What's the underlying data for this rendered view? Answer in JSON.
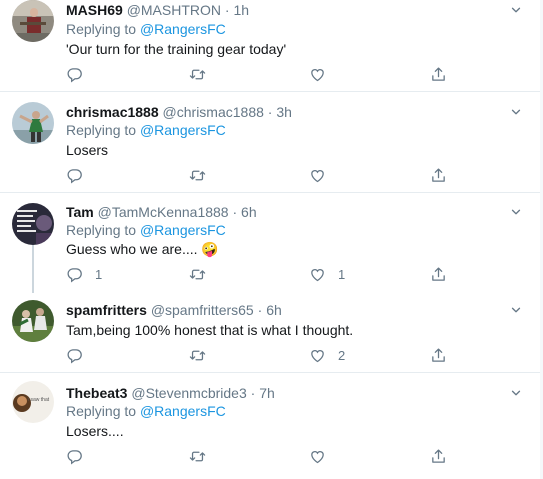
{
  "tweets": [
    {
      "name": "MASH69",
      "handle": "@MASHTRON",
      "dot": "·",
      "time": "1h",
      "replying_prefix": "Replying to",
      "replying_to": "@RangersFC",
      "text": "'Our turn for the training gear today'",
      "replies": "",
      "retweets": "",
      "likes": ""
    },
    {
      "name": "chrismac1888",
      "handle": "@chrismac1888",
      "dot": "·",
      "time": "3h",
      "replying_prefix": "Replying to",
      "replying_to": "@RangersFC",
      "text": "Losers",
      "replies": "",
      "retweets": "",
      "likes": ""
    },
    {
      "name": "Tam",
      "handle": "@TamMcKenna1888",
      "dot": "·",
      "time": "6h",
      "replying_prefix": "Replying to",
      "replying_to": "@RangersFC",
      "text": "Guess who we are....",
      "emoji": "🤪",
      "replies": "1",
      "retweets": "",
      "likes": "1"
    },
    {
      "name": "spamfritters",
      "handle": "@spamfritters65",
      "dot": "·",
      "time": "6h",
      "text": "Tam,being 100% honest that is what I thought.",
      "replies": "",
      "retweets": "",
      "likes": "2"
    },
    {
      "name": "Thebeat3",
      "handle": "@Stevenmcbride3",
      "dot": "·",
      "time": "7h",
      "replying_prefix": "Replying to",
      "replying_to": "@RangersFC",
      "text": "Losers....",
      "avatar_text": "i saw that",
      "replies": "",
      "retweets": "",
      "likes": ""
    }
  ],
  "colors": {
    "link": "#1b95e0",
    "muted": "#657786",
    "text": "#14171a",
    "separator": "#e6ecf0"
  },
  "icons": [
    "reply-icon",
    "retweet-icon",
    "like-icon",
    "share-icon",
    "chevron-down-icon"
  ]
}
